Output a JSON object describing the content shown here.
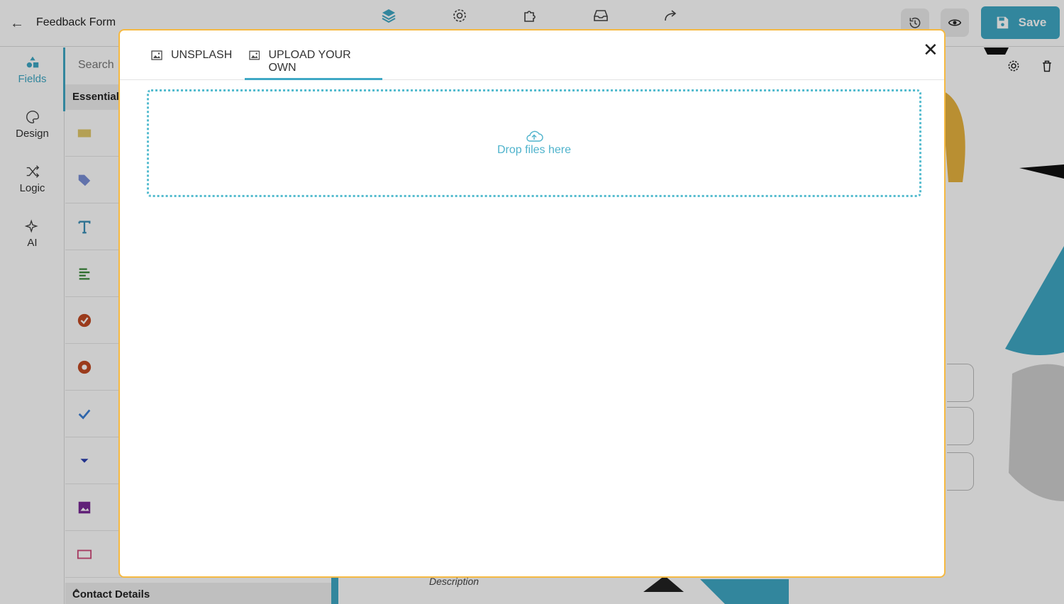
{
  "header": {
    "form_title": "Feedback Form",
    "save_label": "Save",
    "top_icons": [
      "layers-icon",
      "gear-icon",
      "puzzle-icon",
      "inbox-icon",
      "share-icon"
    ]
  },
  "leftnav": {
    "items": [
      {
        "label": "Fields",
        "icon": "shapes-icon"
      },
      {
        "label": "Design",
        "icon": "palette-icon"
      },
      {
        "label": "Logic",
        "icon": "shuffle-icon"
      },
      {
        "label": "AI",
        "icon": "sparkles-icon"
      }
    ]
  },
  "fieldpanel": {
    "search_placeholder": "Search",
    "section_label": "Essentials",
    "footer_section": "Contact Details"
  },
  "canvas": {
    "description_label": "Description"
  },
  "modal": {
    "tabs": [
      {
        "label": "UNSPLASH",
        "active": false
      },
      {
        "label": "UPLOAD YOUR OWN",
        "active": true
      }
    ],
    "dropzone_text": "Drop files here"
  },
  "colors": {
    "accent": "#3fa8c5",
    "modal_border": "#f5b942",
    "dropzone": "#55bccf"
  }
}
